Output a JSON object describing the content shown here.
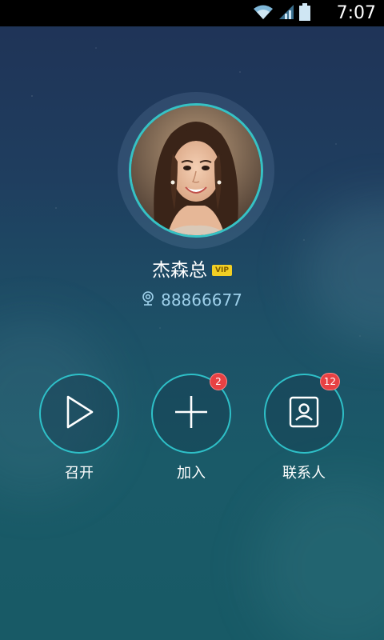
{
  "status_bar": {
    "time": "7:07",
    "icons": [
      "wifi-icon",
      "signal-icon",
      "battery-icon"
    ]
  },
  "profile": {
    "name": "杰森总",
    "vip_badge": "VIP",
    "id_number": "88866677",
    "id_icon": "webcam-icon"
  },
  "actions": [
    {
      "label": "召开",
      "icon": "play-icon",
      "badge": ""
    },
    {
      "label": "加入",
      "icon": "plus-icon",
      "badge": "2"
    },
    {
      "label": "联系人",
      "icon": "contact-card-icon",
      "badge": "12"
    }
  ],
  "colors": {
    "ring_accent": "#2ec0c8",
    "badge_red": "#e84143",
    "vip_yellow": "#f2cf24",
    "id_text": "#9ed0ea"
  }
}
